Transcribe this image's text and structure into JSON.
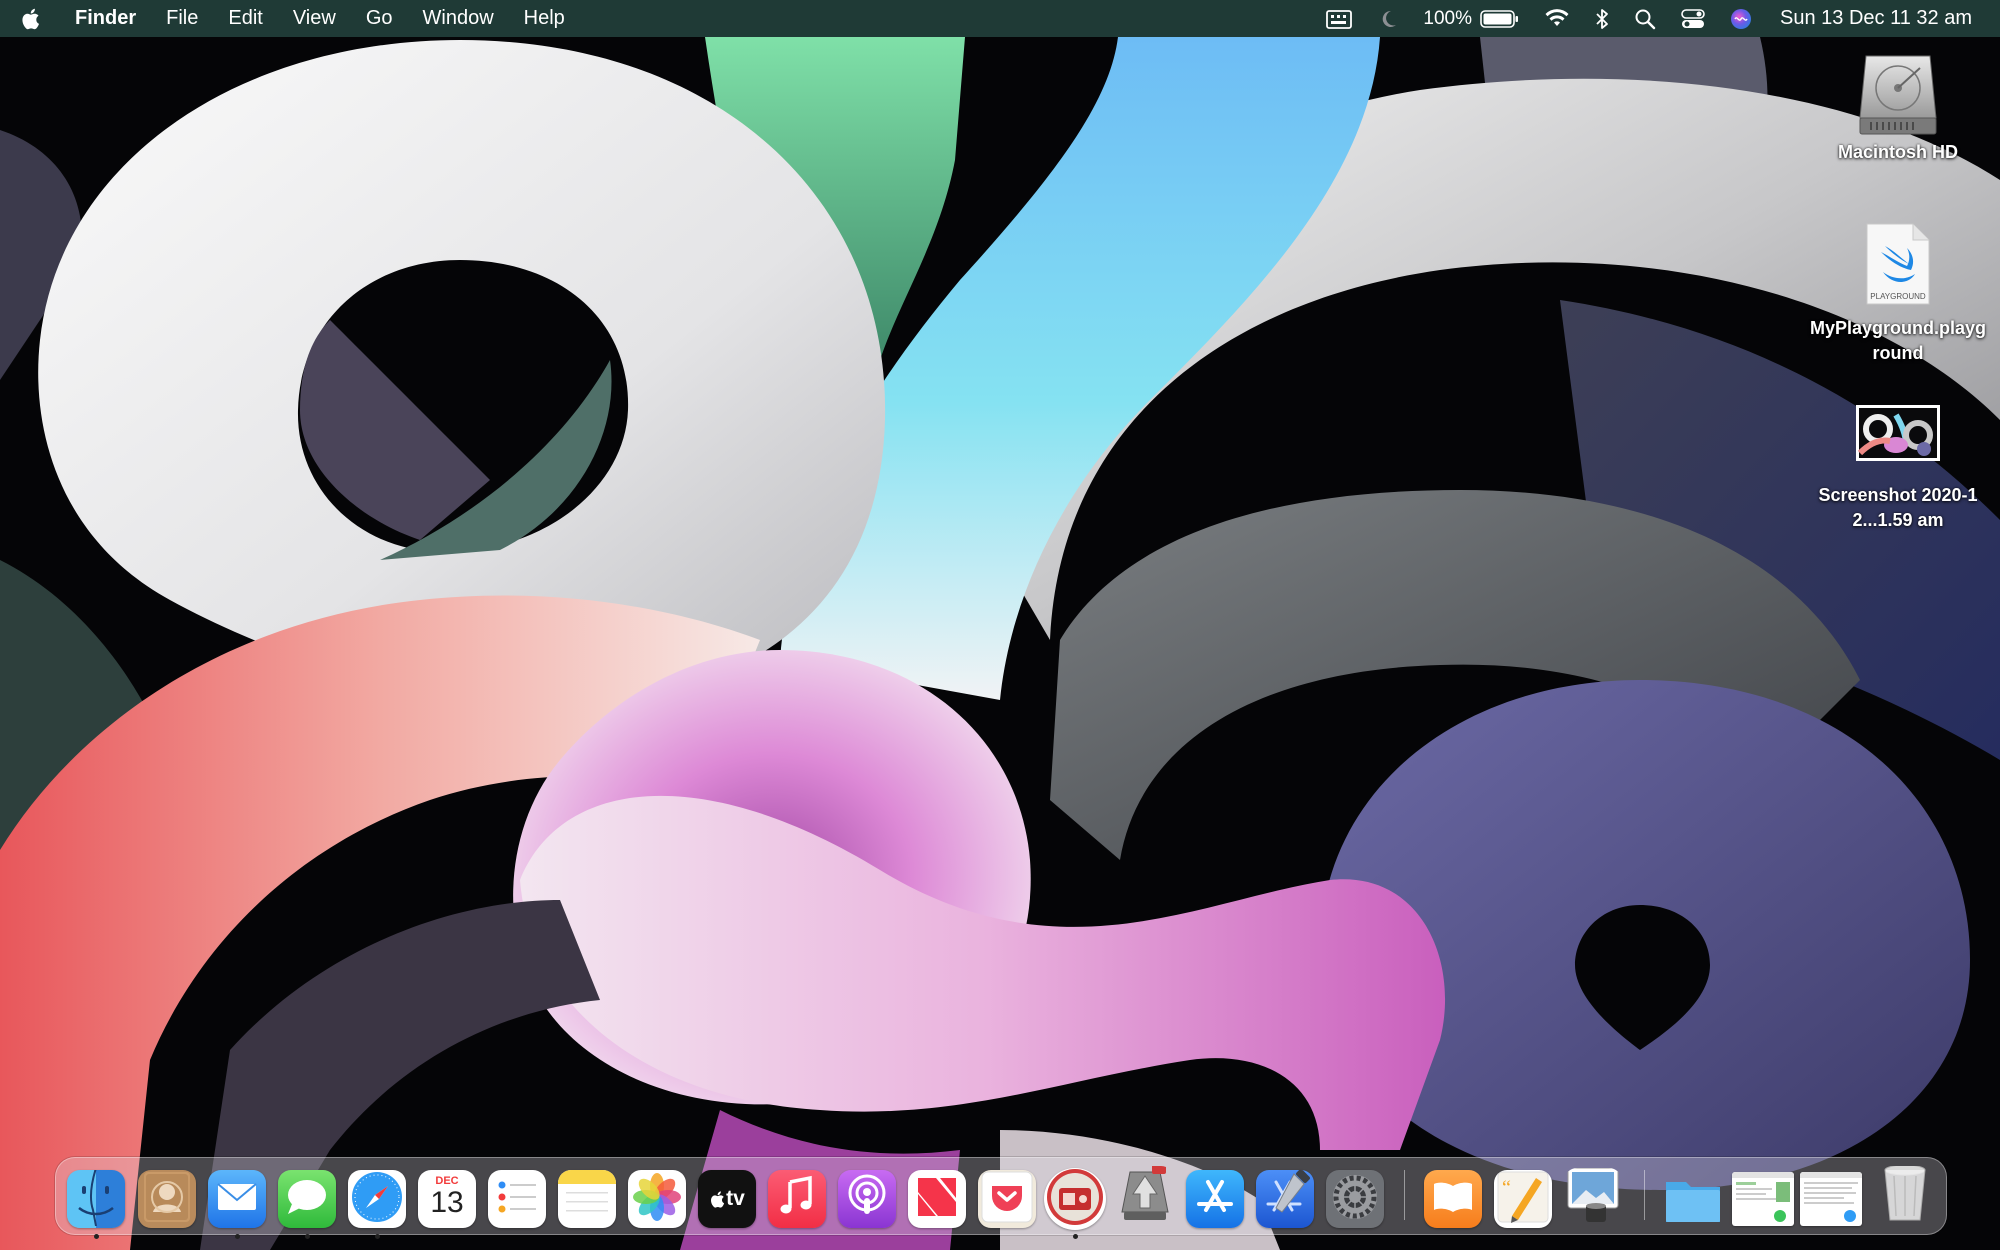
{
  "menubar": {
    "apple_icon": "apple-logo-icon",
    "app_name": "Finder",
    "menus": [
      "File",
      "Edit",
      "View",
      "Go",
      "Window",
      "Help"
    ],
    "status": {
      "input_icon": "keyboard-input-icon",
      "focus_icon": "moon-icon",
      "battery_percent": "100%",
      "battery_icon": "battery-icon",
      "wifi_icon": "wifi-icon",
      "bluetooth_icon": "bluetooth-icon",
      "search_icon": "search-icon",
      "control_center_icon": "control-center-icon",
      "siri_icon": "siri-icon",
      "clock": "Sun 13 Dec  11 32 am"
    }
  },
  "desktop": {
    "icons": [
      {
        "label": "Macintosh HD",
        "icon": "hard-drive-icon"
      },
      {
        "label": "MyPlayground.playground",
        "icon": "swift-playground-icon",
        "badge": "PLAYGROUND"
      },
      {
        "label": "Screenshot 2020-12...1.59 am",
        "icon": "screenshot-thumbnail-icon"
      }
    ]
  },
  "dock": {
    "apps": [
      {
        "name": "Finder",
        "icon": "finder-icon",
        "running": true
      },
      {
        "name": "Contacts",
        "icon": "contacts-icon",
        "running": false
      },
      {
        "name": "Mail",
        "icon": "mail-icon",
        "running": true
      },
      {
        "name": "Messages",
        "icon": "messages-icon",
        "running": true
      },
      {
        "name": "Safari",
        "icon": "safari-icon",
        "running": true
      },
      {
        "name": "Calendar",
        "icon": "calendar-icon",
        "running": false,
        "month": "DEC",
        "day": "13"
      },
      {
        "name": "Reminders",
        "icon": "reminders-icon",
        "running": false
      },
      {
        "name": "Notes",
        "icon": "notes-icon",
        "running": false
      },
      {
        "name": "Photos",
        "icon": "photos-icon",
        "running": false
      },
      {
        "name": "TV",
        "icon": "apple-tv-icon",
        "running": false,
        "text": "tv"
      },
      {
        "name": "Music",
        "icon": "music-icon",
        "running": false
      },
      {
        "name": "Podcasts",
        "icon": "podcasts-icon",
        "running": false
      },
      {
        "name": "News",
        "icon": "news-icon",
        "running": false
      },
      {
        "name": "Pocket",
        "icon": "pocket-icon",
        "running": false
      },
      {
        "name": "Radio",
        "icon": "radio-icon",
        "running": true
      },
      {
        "name": "Transmit",
        "icon": "transmit-icon",
        "running": false
      },
      {
        "name": "App Store",
        "icon": "app-store-icon",
        "running": false
      },
      {
        "name": "Xcode",
        "icon": "xcode-icon",
        "running": false
      },
      {
        "name": "System Preferences",
        "icon": "system-preferences-icon",
        "running": false
      },
      {
        "name": "Books",
        "icon": "books-icon",
        "running": false
      },
      {
        "name": "Pages",
        "icon": "pages-icon",
        "running": false
      },
      {
        "name": "Preview",
        "icon": "preview-icon",
        "running": false
      },
      {
        "name": "Downloads",
        "icon": "folder-icon",
        "running": false
      },
      {
        "name": "Recent Window 1",
        "icon": "window-thumbnail-icon",
        "running": false
      },
      {
        "name": "Recent Window 2",
        "icon": "window-thumbnail-icon",
        "running": false
      },
      {
        "name": "Trash",
        "icon": "trash-icon",
        "running": false
      }
    ]
  },
  "colors": {
    "menubar_bg": "#1f3a36",
    "wallpaper_bg": "#000000",
    "accent_blue": "#1e88e5"
  }
}
